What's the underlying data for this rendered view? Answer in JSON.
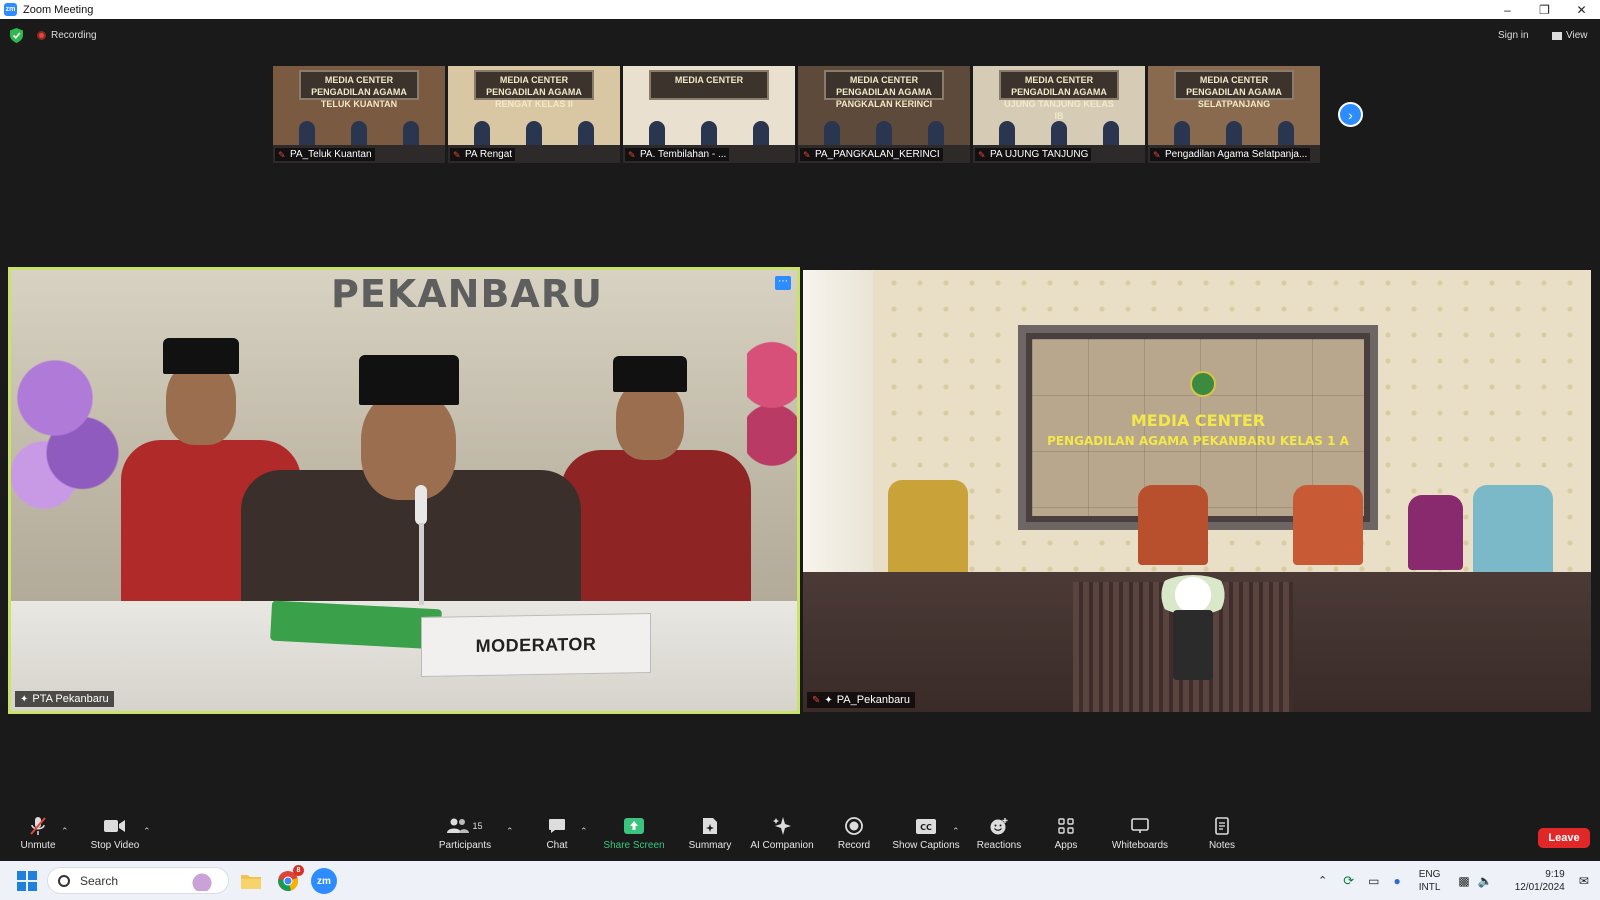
{
  "window": {
    "title": "Zoom Meeting",
    "app_icon": "zoom-icon",
    "controls": [
      "minimize",
      "restore",
      "close"
    ]
  },
  "topbar": {
    "recording_label": "Recording",
    "sign_in_label": "Sign in",
    "view_label": "View"
  },
  "thumbnails": [
    {
      "name": "PA_Teluk Kuantan",
      "banner": "MEDIA CENTER PENGADILAN AGAMA TELUK KUANTAN",
      "bg": "#7a5a40"
    },
    {
      "name": "PA Rengat",
      "banner": "MEDIA CENTER PENGADILAN AGAMA RENGAT KELAS II",
      "bg": "#d9c7a3"
    },
    {
      "name": "PA. Tembilahan - ...",
      "banner": "MEDIA CENTER",
      "bg": "#e9e0cf"
    },
    {
      "name": "PA_PANGKALAN_KERINCI",
      "banner": "MEDIA CENTER PENGADILAN AGAMA PANGKALAN KERINCI",
      "bg": "#5d4a3a"
    },
    {
      "name": "PA UJUNG TANJUNG",
      "banner": "MEDIA CENTER PENGADILAN AGAMA UJUNG TANJUNG KELAS IB",
      "bg": "#d6ccb6"
    },
    {
      "name": "Pengadilan Agama Selatpanja...",
      "banner": "MEDIA CENTER PENGADILAN AGAMA SELATPANJANG",
      "bg": "#8a6a4e"
    }
  ],
  "main_tiles": {
    "left": {
      "name": "PTA Pekanbaru",
      "wall_text": "PEKANBARU",
      "card_text": "MODERATOR",
      "active_speaker_color": "#c9e36a"
    },
    "right": {
      "name": "PA_Pekanbaru",
      "banner_line1": "MEDIA CENTER",
      "banner_line2": "PENGADILAN AGAMA PEKANBARU KELAS 1 A"
    }
  },
  "toolbar": {
    "unmute": "Unmute",
    "stop_video": "Stop Video",
    "participants": "Participants",
    "participants_count": "15",
    "chat": "Chat",
    "share_screen": "Share Screen",
    "summary": "Summary",
    "ai_companion": "AI Companion",
    "record": "Record",
    "show_captions": "Show Captions",
    "reactions": "Reactions",
    "apps": "Apps",
    "whiteboards": "Whiteboards",
    "notes": "Notes",
    "leave": "Leave",
    "share_color": "#3ac47d",
    "leave_color": "#e02828"
  },
  "taskbar": {
    "search_placeholder": "Search",
    "lang_line1": "ENG",
    "lang_line2": "INTL",
    "time": "9:19",
    "date": "12/01/2024",
    "chrome_badge": "8"
  }
}
